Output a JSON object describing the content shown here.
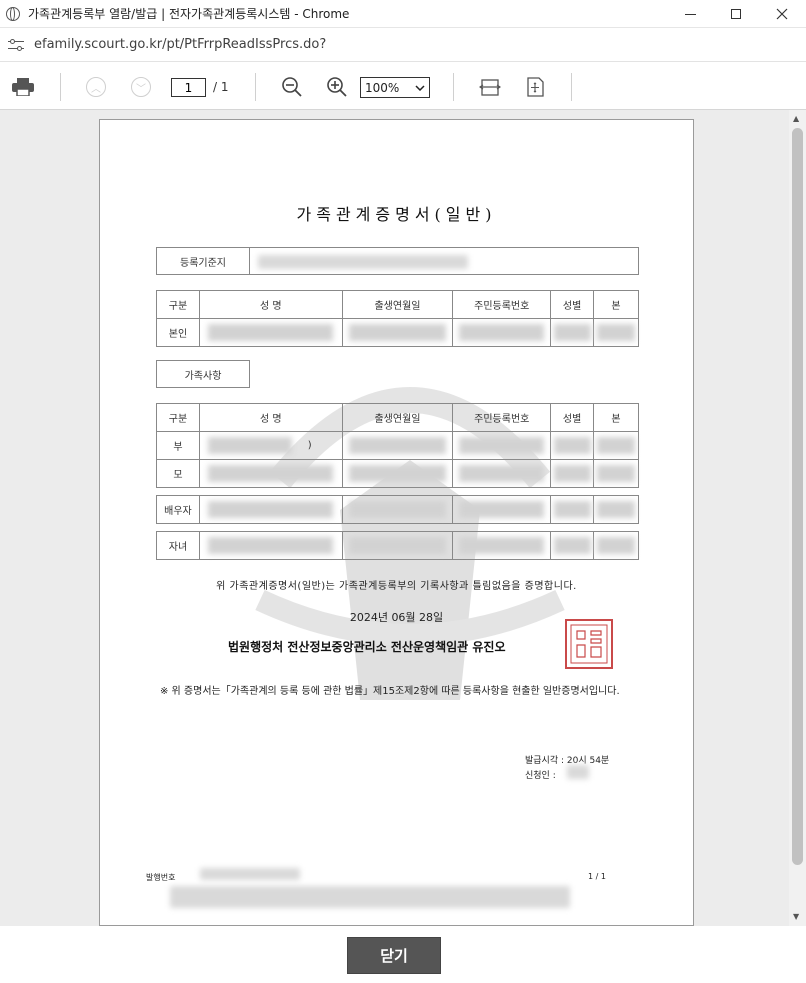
{
  "window": {
    "title": "가족관계등록부 열람/발급 | 전자가족관계등록시스템 - Chrome",
    "url": "efamily.scourt.go.kr/pt/PtFrrpReadIssPrcs.do?"
  },
  "toolbar": {
    "page_current": "1",
    "page_total": "/ 1",
    "zoom": "100%"
  },
  "document": {
    "title": "가족관계증명서(일반)",
    "reg_label": "등록기준지",
    "headers": [
      "구분",
      "성 명",
      "출생연월일",
      "주민등록번호",
      "성별",
      "본"
    ],
    "self_label": "본인",
    "family_section_label": "가족사항",
    "family_rows": [
      {
        "relation": "부",
        "name_suffix": ")"
      },
      {
        "relation": "모",
        "name_suffix": ""
      },
      {
        "relation": "배우자",
        "name_suffix": ""
      },
      {
        "relation": "자녀",
        "name_suffix": ""
      }
    ],
    "certify_text": "위 가족관계증명서(일반)는 가족관계등록부의 기록사항과 틀림없음을 증명합니다.",
    "date": "2024년 06월 28일",
    "issuer": "법원행정처 전산정보중앙관리소 전산운영책임관 유진오",
    "note": "※ 위 증명서는「가족관계의 등록 등에 관한 법률」제15조제2항에 따른 등록사항을 현출한 일반증명서입니다.",
    "issue_time": "발급시각 : 20시 54분",
    "applicant": "신청인 :",
    "issue_no_label": "발행번호",
    "page_indicator": "1 / 1"
  },
  "footer": {
    "close_label": "닫기"
  },
  "colors": {
    "close_button": "#555555",
    "seal": "#c94a4a",
    "viewport": "#ececec"
  }
}
